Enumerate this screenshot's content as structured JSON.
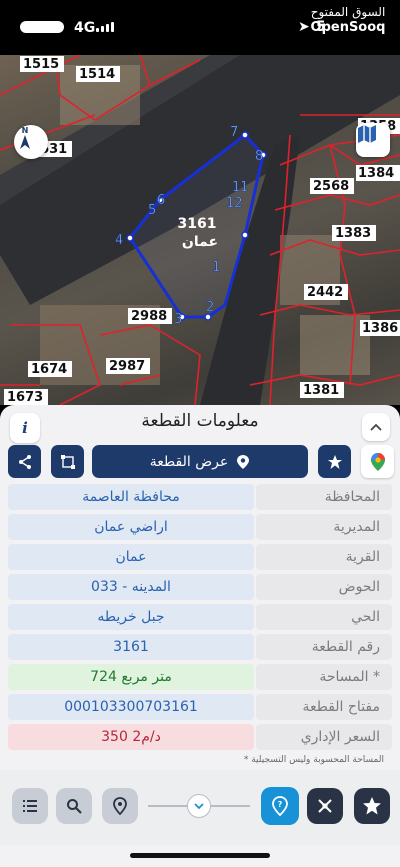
{
  "status_bar": {
    "network": "4G",
    "battery": "5"
  },
  "brand": {
    "arabic": "السوق المفتوح",
    "name": "OpenSooq"
  },
  "map": {
    "parcel_numbers": [
      "1515",
      "1514",
      "1631",
      "1358",
      "2568",
      "1384",
      "1383",
      "2442",
      "1386",
      "2988",
      "2987",
      "1674",
      "1381",
      "1673"
    ],
    "selected_parcel": {
      "number": "3161",
      "name": "عمان"
    },
    "vertex_labels": [
      "1",
      "2",
      "3",
      "4",
      "5",
      "6",
      "7",
      "8",
      "11",
      "12"
    ],
    "compass_label": "N",
    "polygon_color": "#1630d6",
    "boundary_color": "#e1212b"
  },
  "sheet": {
    "title": "معلومات القطعة",
    "info_icon": "i",
    "show_plot_label": "عرض القطعة"
  },
  "details": [
    {
      "label": "المحافظة",
      "value": "محافظة العاصمة"
    },
    {
      "label": "المديرية",
      "value": "اراضي عمان"
    },
    {
      "label": "القرية",
      "value": "عمان"
    },
    {
      "label": "الحوض",
      "value": "المدينه - 033"
    },
    {
      "label": "الحي",
      "value": "جبل خريطه"
    },
    {
      "label": "رقم القطعة",
      "value": "3161"
    },
    {
      "label": "المساحة *",
      "value": "724   متر مربع"
    },
    {
      "label": "مفتاح القطعة",
      "value": "000103300703161"
    },
    {
      "label": "السعر الإداري",
      "value": "350 د/م2"
    }
  ],
  "footnote": "* المساحة المحسوبة وليس التسجيلية",
  "toolbar": {
    "icons": [
      "list-icon",
      "search-icon",
      "location-pin-icon",
      "chevron-down-icon",
      "help-location-icon",
      "satellite-icon",
      "star-icon"
    ]
  }
}
